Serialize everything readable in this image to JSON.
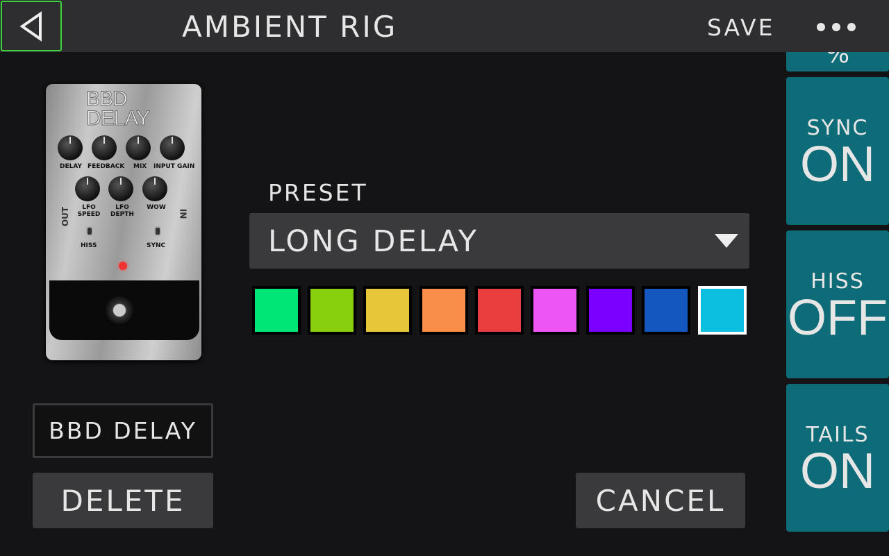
{
  "header": {
    "title": "AMBIENT RIG",
    "save_label": "SAVE",
    "back_icon": "triangle-left-icon",
    "more_icon": "ellipsis-icon"
  },
  "pedal": {
    "name_line1": "BBD",
    "name_line2": "DELAY",
    "knobs": [
      "DELAY",
      "FEEDBACK",
      "MIX",
      "INPUT GAIN"
    ],
    "knobs2": [
      "LFO\nSPEED",
      "LFO\nDEPTH",
      "WOW"
    ],
    "toggles": [
      "HISS",
      "SYNC"
    ],
    "out": "OUT",
    "in": "IN"
  },
  "model_name": "BBD DELAY",
  "delete_label": "DELETE",
  "cancel_label": "CANCEL",
  "preset": {
    "label": "PRESET",
    "value": "LONG DELAY"
  },
  "colors": {
    "swatches": [
      "#00e676",
      "#88d00e",
      "#e8c63a",
      "#f78f4a",
      "#e83e3e",
      "#ee55f5",
      "#7b00ff",
      "#1457bf",
      "#0cbfe0"
    ],
    "selected_index": 8,
    "accent": "#0e6b78"
  },
  "side_params": [
    {
      "label": "",
      "value": "%"
    },
    {
      "label": "SYNC",
      "value": "ON"
    },
    {
      "label": "HISS",
      "value": "OFF"
    },
    {
      "label": "TAILS",
      "value": "ON"
    }
  ]
}
